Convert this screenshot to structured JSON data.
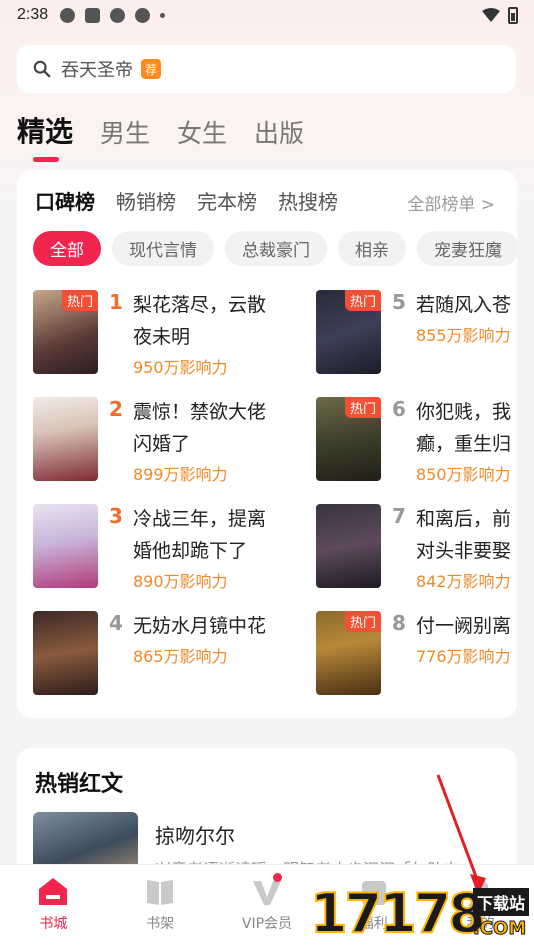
{
  "status": {
    "time": "2:38"
  },
  "search": {
    "query": "吞天圣帝",
    "badge": "荐"
  },
  "top_tabs": [
    {
      "label": "精选",
      "active": true
    },
    {
      "label": "男生"
    },
    {
      "label": "女生"
    },
    {
      "label": "出版"
    }
  ],
  "rank_tabs": [
    {
      "label": "口碑榜",
      "active": true
    },
    {
      "label": "畅销榜"
    },
    {
      "label": "完本榜"
    },
    {
      "label": "热搜榜"
    }
  ],
  "all_ranks_label": "全部榜单 >",
  "chips": [
    "全部",
    "现代言情",
    "总裁豪门",
    "相亲",
    "宠妻狂魔"
  ],
  "books": [
    {
      "rank": "1",
      "title": "梨花落尽，云散夜未明",
      "influence": "950万影响力",
      "hot": "热门"
    },
    {
      "rank": "2",
      "title": "震惊！禁欲大佬闪婚了",
      "influence": "899万影响力",
      "hot": ""
    },
    {
      "rank": "3",
      "title": "冷战三年，提离婚他却跪下了",
      "influence": "890万影响力",
      "hot": ""
    },
    {
      "rank": "4",
      "title": "无妨水月镜中花",
      "influence": "865万影响力",
      "hot": ""
    },
    {
      "rank": "5",
      "title": "若随风入苍",
      "influence": "855万影响力",
      "hot": "热门"
    },
    {
      "rank": "6",
      "title": "你犯贱，我癫，重生归",
      "influence": "850万影响力",
      "hot": "热门"
    },
    {
      "rank": "7",
      "title": "和离后，前对头非要娶",
      "influence": "842万影响力",
      "hot": ""
    },
    {
      "rank": "8",
      "title": "付一阙别离",
      "influence": "776万影响力",
      "hot": "热门"
    }
  ],
  "hot_section": {
    "title": "热销红文",
    "book_title": "掠吻尔尔",
    "desc": "兴意老语逝请瑶，明智者止步汩汩「勿助志"
  },
  "nav": [
    {
      "label": "书城",
      "active": true
    },
    {
      "label": "书架"
    },
    {
      "label": "VIP会员"
    },
    {
      "label": "福利"
    },
    {
      "label": "我的"
    }
  ],
  "watermark": {
    "number": "17178",
    "site": "下载站",
    "com": ".COM"
  },
  "colors": {
    "accent": "#f0264e",
    "orange": "#f08a2a",
    "hot": "#f25035"
  }
}
